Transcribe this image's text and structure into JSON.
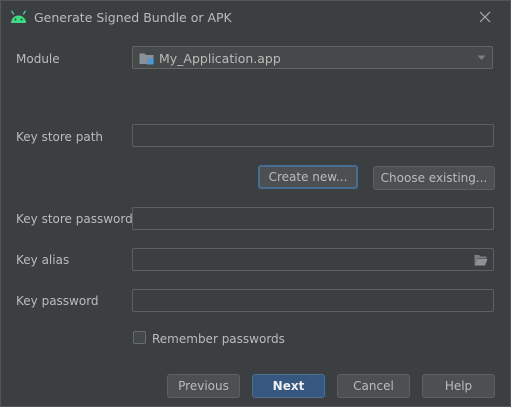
{
  "window": {
    "title": "Generate Signed Bundle or APK",
    "app_icon": "android-icon",
    "close_icon": "close-icon"
  },
  "module": {
    "label": "Module",
    "selected": "My_Application.app",
    "icon": "module-folder-icon"
  },
  "key_store_path": {
    "label": "Key store path",
    "value": ""
  },
  "key_store_buttons": {
    "create_new": "Create new...",
    "choose_existing": "Choose existing..."
  },
  "key_store_password": {
    "label": "Key store password",
    "value": ""
  },
  "key_alias": {
    "label": "Key alias",
    "value": "",
    "browse_icon": "folder-open-icon"
  },
  "key_password": {
    "label": "Key password",
    "value": ""
  },
  "remember": {
    "label": "Remember passwords",
    "checked": false
  },
  "footer": {
    "previous": "Previous",
    "next": "Next",
    "cancel": "Cancel",
    "help": "Help"
  },
  "colors": {
    "dialog_bg": "#3c3f41",
    "field_bg": "#45494a",
    "primary_button": "#365880",
    "focus_ring": "#466d94",
    "android_green": "#3ddc84"
  }
}
